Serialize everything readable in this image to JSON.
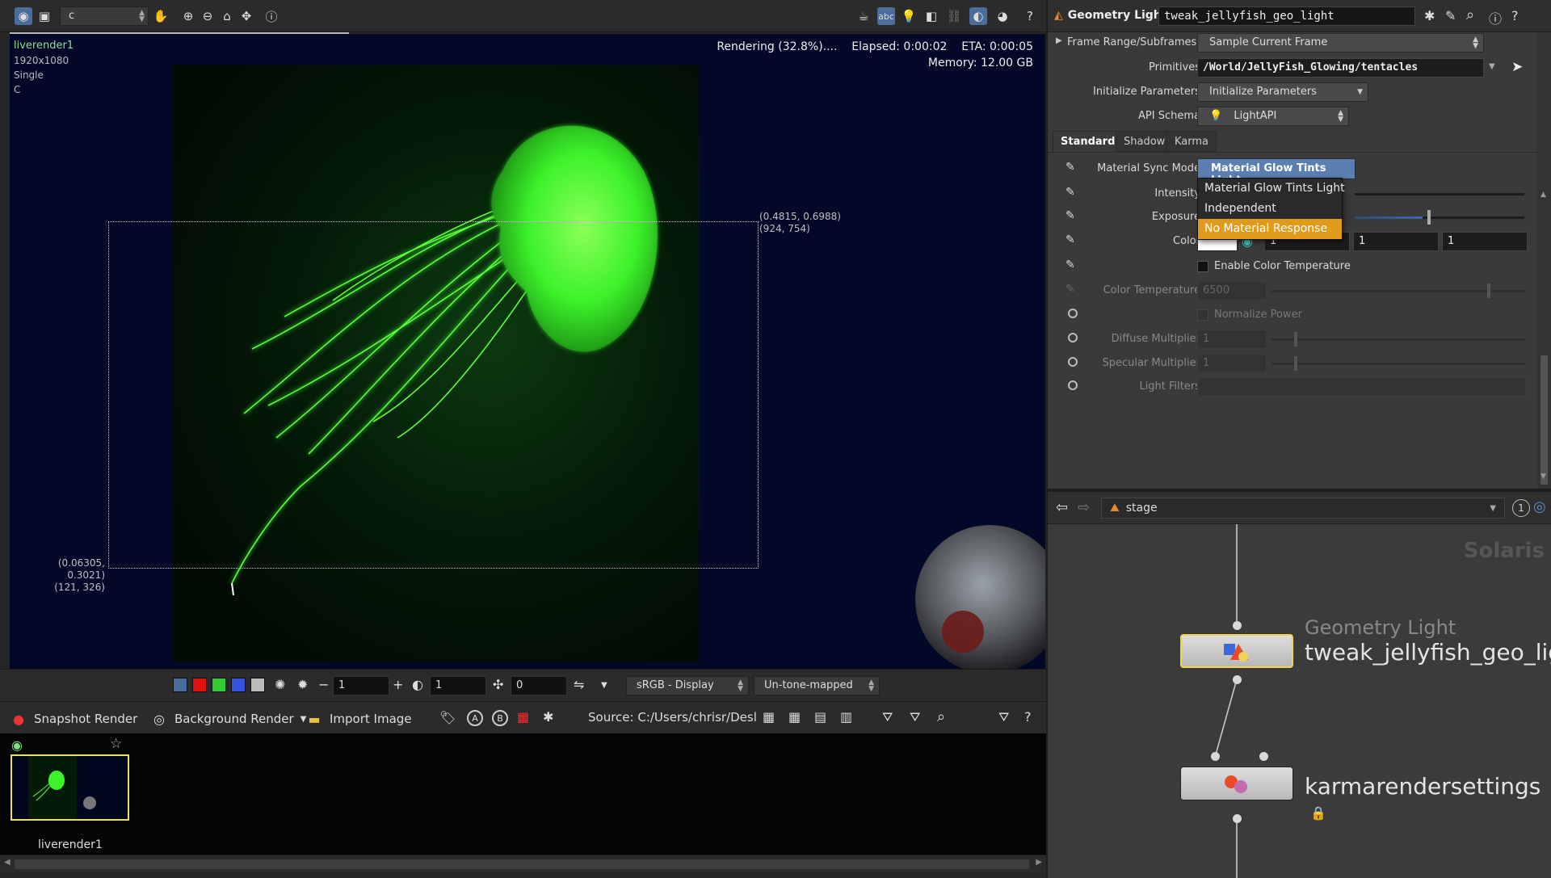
{
  "viewer": {
    "camera_menu_value": "c",
    "render_name": "liverender1",
    "resolution": "1920x1080",
    "mode": "Single",
    "extra": "C",
    "status_line": "Rendering (32.8%)....",
    "elapsed": "Elapsed: 0:00:02",
    "eta": "ETA: 0:00:05",
    "memory": "Memory:      12.00 GB",
    "progress_percent": 32.8,
    "region_top_right_norm": "(0.4815, 0.6988)",
    "region_top_right_px": "(924, 754)",
    "region_bottom_left_norm": "(0.06305, 0.3021)",
    "region_bottom_left_px": "(121, 326)",
    "bottom_bar": {
      "exposure_value": "1",
      "gamma_value": "1",
      "frame_value": "0",
      "color_space": "sRGB - Display",
      "tonemap": "Un-tone-mapped"
    },
    "snapshot_bar": {
      "snapshot_render": "Snapshot Render",
      "background_render": "Background Render",
      "import_image": "Import Image",
      "label_a": "A",
      "label_b": "B",
      "source": "Source: C:/Users/chrisr/Desl"
    },
    "gallery": {
      "thumb_label": "liverender1"
    }
  },
  "params": {
    "node_type": "Geometry Light",
    "node_name": "tweak_jellyfish_geo_light",
    "rows": {
      "frame_range": {
        "label": "Frame Range/Subframes",
        "value": "Sample Current Frame"
      },
      "primitives": {
        "label": "Primitives",
        "value": "/World/JellyFish_Glowing/tentacles"
      },
      "init_params": {
        "label": "Initialize Parameters",
        "value": "Initialize Parameters"
      },
      "api_schema": {
        "label": "API Schema",
        "value": "LightAPI"
      }
    },
    "tabs": [
      "Standard",
      "Shadow",
      "Karma"
    ],
    "material_sync": {
      "label": "Material Sync Mode",
      "selected": "Material Glow Tints Light",
      "options": [
        "Material Glow Tints Light",
        "Independent",
        "No Material Response"
      ],
      "hovered_index": 2
    },
    "intensity": {
      "label": "Intensity"
    },
    "exposure": {
      "label": "Exposure"
    },
    "color": {
      "label": "Color",
      "r": "1",
      "g": "1",
      "b": "1"
    },
    "enable_color_temp": {
      "label": "Enable Color Temperature"
    },
    "color_temp": {
      "label": "Color Temperature",
      "value": "6500"
    },
    "normalize_power": {
      "label": "Normalize Power"
    },
    "diffuse_mult": {
      "label": "Diffuse Multiplier",
      "value": "1"
    },
    "specular_mult": {
      "label": "Specular Multiplier",
      "value": "1"
    },
    "light_filters": {
      "label": "Light Filters"
    }
  },
  "network": {
    "path": "stage",
    "context_label": "Solaris",
    "badge": "1",
    "nodes": [
      {
        "type_label": "Geometry Light",
        "name": "tweak_jellyfish_geo_lig"
      },
      {
        "type_label": "",
        "name": "karmarendersettings"
      }
    ]
  },
  "colors": {
    "accent_blue": "#5a7fb0",
    "hover_orange": "#e29a1a",
    "selected_node_outline": "#f2d44a",
    "jellyfish_green": "#39ff2a",
    "render_bg": "#020828"
  }
}
